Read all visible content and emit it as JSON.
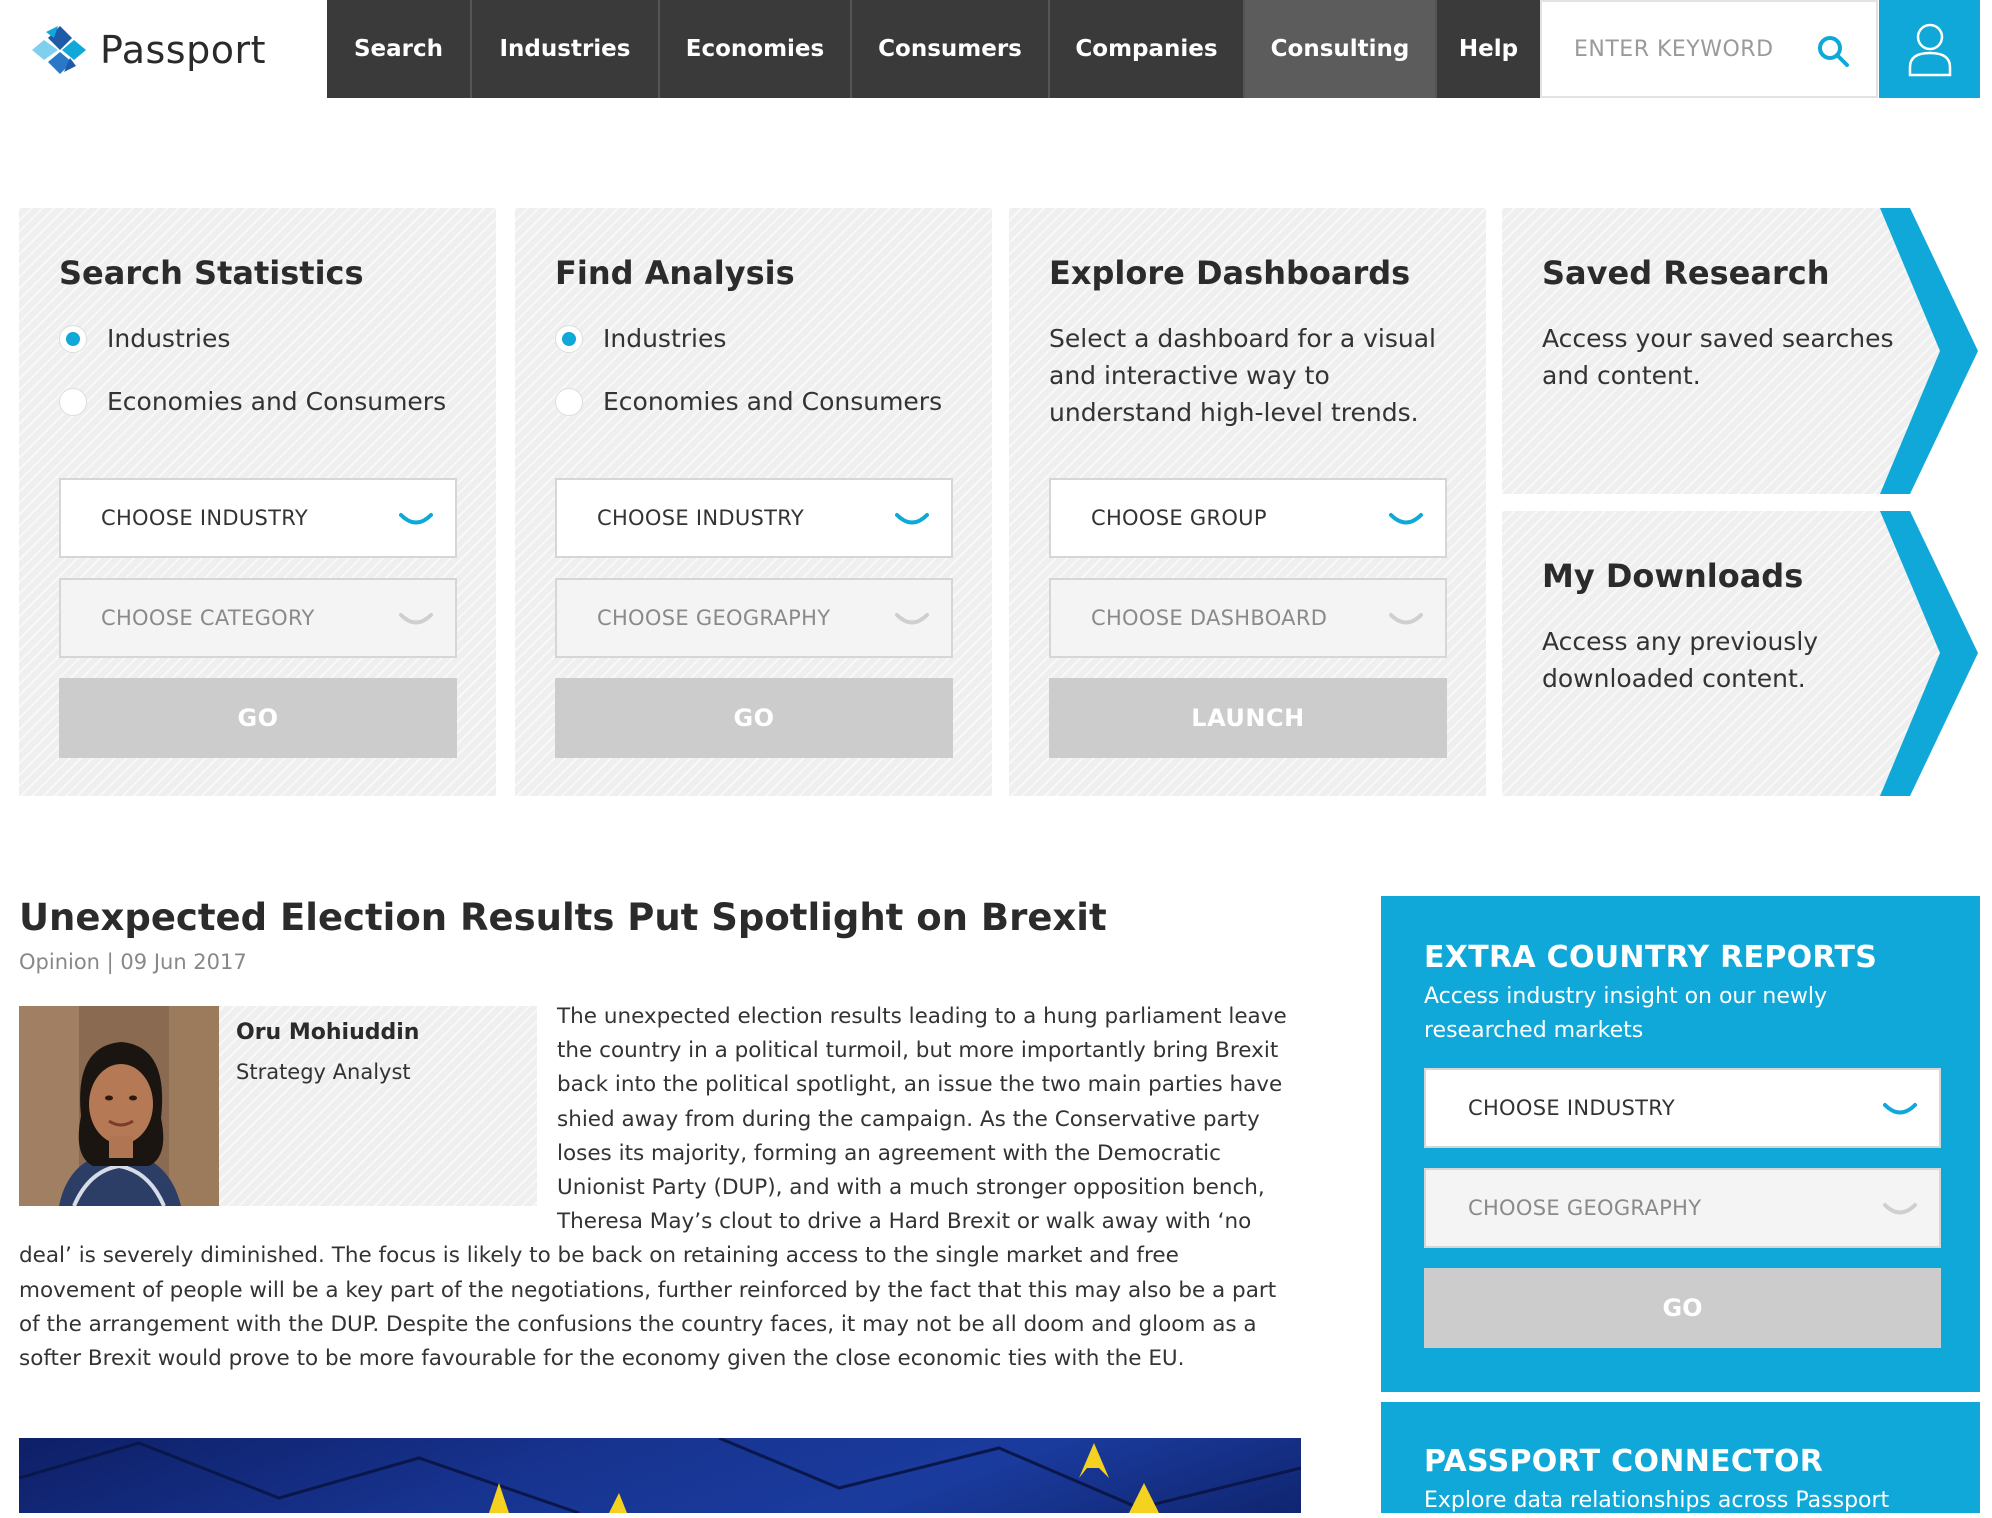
{
  "brand": {
    "name": "Passport"
  },
  "nav": {
    "items": [
      {
        "label": "Search"
      },
      {
        "label": "Industries"
      },
      {
        "label": "Economies"
      },
      {
        "label": "Consumers"
      },
      {
        "label": "Companies"
      },
      {
        "label": "Consulting"
      },
      {
        "label": "Help"
      }
    ],
    "search_placeholder": "ENTER KEYWORD"
  },
  "tiles": {
    "search_statistics": {
      "title": "Search Statistics",
      "radio_1": "Industries",
      "radio_2": "Economies and Consumers",
      "select_1": "CHOOSE INDUSTRY",
      "select_2": "CHOOSE CATEGORY",
      "button": "GO"
    },
    "find_analysis": {
      "title": "Find Analysis",
      "radio_1": "Industries",
      "radio_2": "Economies and Consumers",
      "select_1": "CHOOSE INDUSTRY",
      "select_2": "CHOOSE GEOGRAPHY",
      "button": "GO"
    },
    "explore_dashboards": {
      "title": "Explore Dashboards",
      "description": "Select a dashboard for a visual and interactive way to understand high-level trends.",
      "select_1": "CHOOSE GROUP",
      "select_2": "CHOOSE DASHBOARD",
      "button": "LAUNCH"
    },
    "saved_research": {
      "title": "Saved Research",
      "description": "Access your saved searches and content."
    },
    "my_downloads": {
      "title": "My Downloads",
      "description": "Access any previously downloaded content."
    }
  },
  "article": {
    "title": "Unexpected Election Results Put Spotlight on Brexit",
    "meta": "Opinion | 09 Jun 2017",
    "author_name": "Oru Mohiuddin",
    "author_role": "Strategy Analyst",
    "body": "The unexpected election results leading to a hung parliament leave the country in a political turmoil, but more importantly bring Brexit back into the political spotlight, an issue the two main parties have shied away from during the campaign. As the Conservative party loses its majority, forming an agreement with the Democratic Unionist Party (DUP), and with a much stronger opposition bench, Theresa May’s clout to drive a Hard Brexit or walk away with ‘no deal’ is severely diminished. The focus is likely to be back on retaining access to the single market and free movement of people will be a key part of the negotiations, further reinforced by the fact that this may also be a part of the arrangement with the DUP. Despite the confusions the country faces, it may not be all doom and gloom as a softer Brexit would prove to be more favourable for the economy given the close economic ties with the EU."
  },
  "sidebar": {
    "extra_reports": {
      "title": "EXTRA COUNTRY REPORTS",
      "subtitle": "Access industry insight on our newly researched markets",
      "select_1": "CHOOSE INDUSTRY",
      "select_2": "CHOOSE GEOGRAPHY",
      "button": "GO"
    },
    "connector": {
      "title": "PASSPORT CONNECTOR",
      "subtitle": "Explore data relationships across Passport"
    }
  },
  "colors": {
    "accent": "#0fa8d8",
    "nav_bg": "#3a3a3a",
    "nav_active_bg": "#5c5c5c",
    "button_disabled": "#cccccc"
  }
}
